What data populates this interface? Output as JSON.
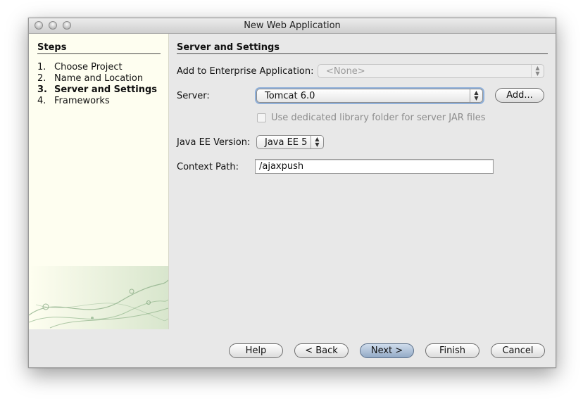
{
  "window": {
    "title": "New Web Application"
  },
  "steps": {
    "heading": "Steps",
    "items": [
      {
        "num": "1.",
        "label": "Choose Project"
      },
      {
        "num": "2.",
        "label": "Name and Location"
      },
      {
        "num": "3.",
        "label": "Server and Settings"
      },
      {
        "num": "4.",
        "label": "Frameworks"
      }
    ]
  },
  "form": {
    "heading": "Server and Settings",
    "enterprise_label": "Add to Enterprise Application:",
    "enterprise_value": "<None>",
    "server_label": "Server:",
    "server_value": "Tomcat 6.0",
    "add_button": "Add...",
    "dedicated_folder_label": "Use dedicated library folder for server JAR files",
    "javaee_label": "Java EE Version:",
    "javaee_value": "Java EE 5",
    "context_label": "Context Path:",
    "context_value": "/ajaxpush"
  },
  "buttons": {
    "help": "Help",
    "back": "< Back",
    "next": "Next >",
    "finish": "Finish",
    "cancel": "Cancel"
  },
  "colors": {
    "steps_panel_bg": "#fefef0",
    "window_bg": "#e8e8e8",
    "default_button": "#a9bdd6"
  }
}
